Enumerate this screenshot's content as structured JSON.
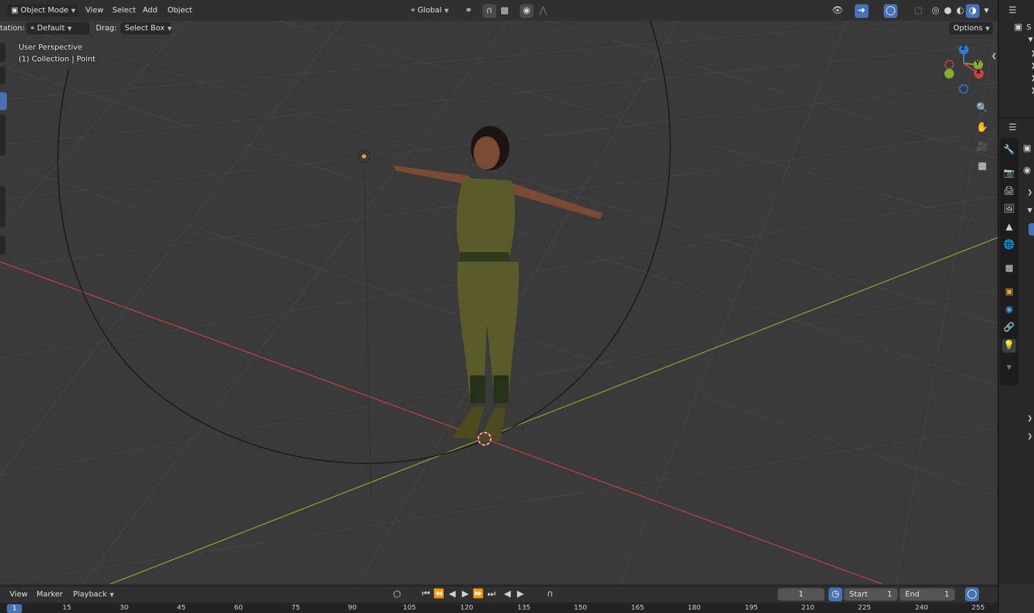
{
  "header": {
    "mode": "Object Mode",
    "menus": [
      "View",
      "Select",
      "Add",
      "Object"
    ],
    "transform_orientation": "Global"
  },
  "tool_header": {
    "orientation_label": "tation:",
    "orientation_value": "Default",
    "drag_label": "Drag:",
    "drag_value": "Select Box",
    "options_label": "Options"
  },
  "viewport": {
    "perspective_label": "User Perspective",
    "collection_label": "(1) Collection | Point",
    "gizmo": {
      "x": "X",
      "y": "Y",
      "z": "Z"
    },
    "colors": {
      "x_axis": "#c9414a",
      "y_axis": "#7fb02c",
      "z_axis": "#2f7ed6",
      "grid": "#4a4a4a"
    }
  },
  "timeline": {
    "menus": [
      "View",
      "Marker",
      "Playback"
    ],
    "current_frame": "1",
    "start_label": "Start",
    "start_value": "1",
    "end_label": "End",
    "end_value": "1",
    "ruler_current": "1",
    "ruler_ticks": [
      "15",
      "30",
      "45",
      "60",
      "75",
      "90",
      "105",
      "120",
      "135",
      "150",
      "165",
      "180",
      "195",
      "210",
      "225",
      "240",
      "255"
    ]
  },
  "outliner": {
    "label": "S"
  },
  "icons": {
    "mode": "object-mode-icon",
    "orientation": "transform-orientation-icon",
    "pivot": "pivot-point-icon",
    "snap": "snap-icon",
    "proportional": "proportional-edit-icon",
    "zoom": "zoom-icon",
    "pan": "pan-hand-icon",
    "camera": "camera-view-icon",
    "ortho": "ortho-grid-icon"
  }
}
